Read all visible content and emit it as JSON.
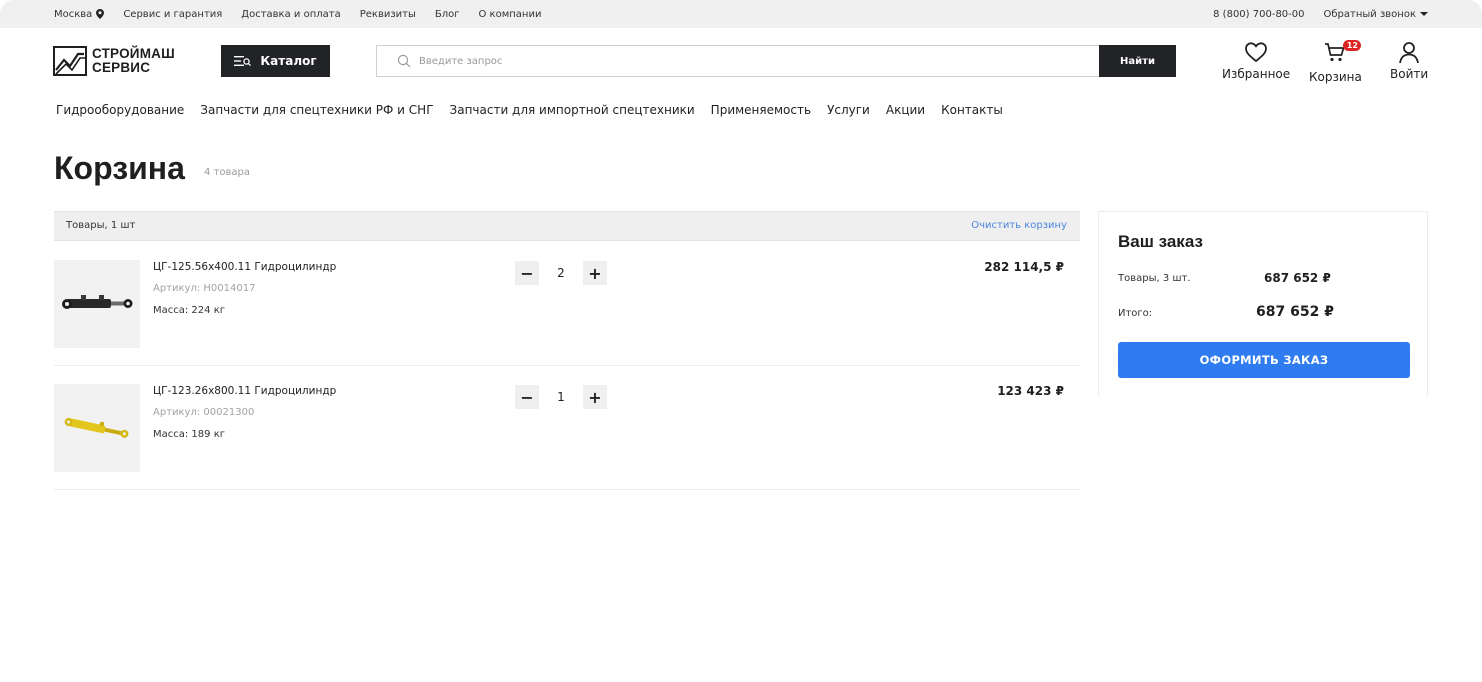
{
  "topbar": {
    "city": "Москва",
    "links": [
      "Сервис и гарантия",
      "Доставка и оплата",
      "Реквизиты",
      "Блог",
      "О компании"
    ],
    "phone": "8 (800) 700-80-00",
    "callback": "Обратный звонок"
  },
  "header": {
    "logo_line1": "СТРОЙМАШ",
    "logo_line2": "СЕРВИС",
    "catalog_label": "Каталог",
    "search_placeholder": "Введите запрос",
    "search_button": "Найти",
    "favorites_label": "Избранное",
    "cart_label": "Корзина",
    "cart_badge": "12",
    "login_label": "Войти"
  },
  "nav": [
    "Гидрооборудование",
    "Запчасти для спецтехники РФ и СНГ",
    "Запчасти для импортной спецтехники",
    "Применяемость",
    "Услуги",
    "Акции",
    "Контакты"
  ],
  "page": {
    "title": "Корзина",
    "count": "4 товара"
  },
  "cart": {
    "header_left": "Товары, 1 шт",
    "clear_label": "Очистить корзину",
    "items": [
      {
        "name": "ЦГ-125.56х400.11 Гидроцилиндр",
        "sku": "Артикул: Н0014017",
        "mass": "Масса: 224 кг",
        "qty": "2",
        "price": "282 114,5 ₽",
        "image_color": "#2a2a2a"
      },
      {
        "name": "ЦГ-123.26х800.11 Гидроцилиндр",
        "sku": "Артикул: 00021300",
        "mass": "Масса: 189 кг",
        "qty": "1",
        "price": "123 423 ₽",
        "image_color": "#e3c61c"
      }
    ],
    "minus": "−",
    "plus": "+"
  },
  "summary": {
    "title": "Ваш заказ",
    "items_label": "Товары, 3 шт.",
    "items_value": "687 652 ₽",
    "total_label": "Итого:",
    "total_value": "687 652 ₽",
    "order_button": "ОФОРМИТЬ ЗАКАЗ"
  },
  "colors": {
    "accent": "#2f7cf0",
    "dark": "#222326",
    "badge": "#e02424",
    "link": "#4c86e0"
  }
}
